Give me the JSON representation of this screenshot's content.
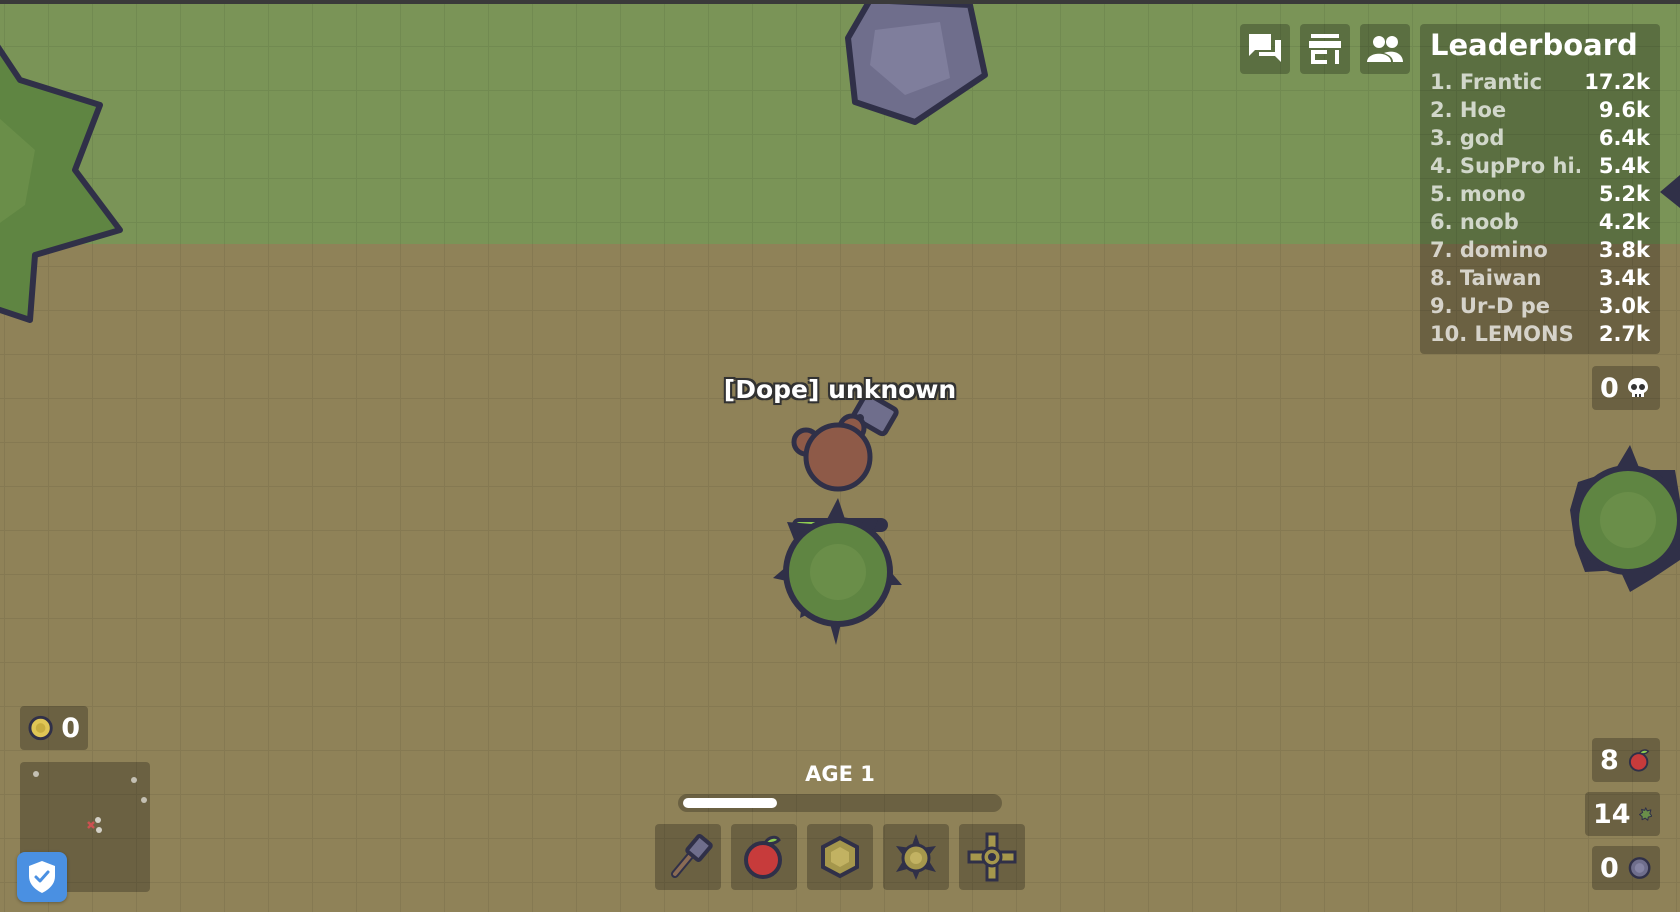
{
  "leaderboard": {
    "title": "Leaderboard",
    "entries": [
      {
        "rank_name": "1. Frantic",
        "score": "17.2k"
      },
      {
        "rank_name": "2. Hoe",
        "score": "9.6k"
      },
      {
        "rank_name": "3. god",
        "score": "6.4k"
      },
      {
        "rank_name": "4. SupPro hi...",
        "score": "5.4k"
      },
      {
        "rank_name": "5. mono",
        "score": "5.2k"
      },
      {
        "rank_name": "6. noob",
        "score": "4.2k"
      },
      {
        "rank_name": "7. domino",
        "score": "3.8k"
      },
      {
        "rank_name": "8. Taiwan",
        "score": "3.4k"
      },
      {
        "rank_name": "9. Ur-D pe",
        "score": "3.0k"
      },
      {
        "rank_name": "10. LEMONS",
        "score": "2.7k"
      }
    ]
  },
  "top_buttons": [
    {
      "icon": "chat-icon"
    },
    {
      "icon": "shop-icon"
    },
    {
      "icon": "clan-icon"
    }
  ],
  "kills": {
    "value": "0",
    "icon": "skull-icon"
  },
  "gold": {
    "value": "0",
    "icon": "gold-coin-icon"
  },
  "resources": {
    "food": {
      "value": "8",
      "icon": "apple-icon"
    },
    "wood": {
      "value": "14",
      "icon": "wood-icon"
    },
    "stone": {
      "value": "0",
      "icon": "stone-icon"
    }
  },
  "player": {
    "name": "[Dope] unknown",
    "health": 0.25
  },
  "age": {
    "label": "AGE 1",
    "progress": 0.3
  },
  "hotbar": [
    {
      "icon": "hammer-icon"
    },
    {
      "icon": "apple-icon"
    },
    {
      "icon": "wood-wall-icon"
    },
    {
      "icon": "spike-icon"
    },
    {
      "icon": "windmill-icon"
    }
  ],
  "colors": {
    "grass": "#7a9457",
    "dirt": "#8f8258",
    "outline": "#303048",
    "bush": "#5f8542",
    "stone": "#6f6e8c",
    "player_skin": "#8e5a48",
    "health": "#8ecc51"
  }
}
